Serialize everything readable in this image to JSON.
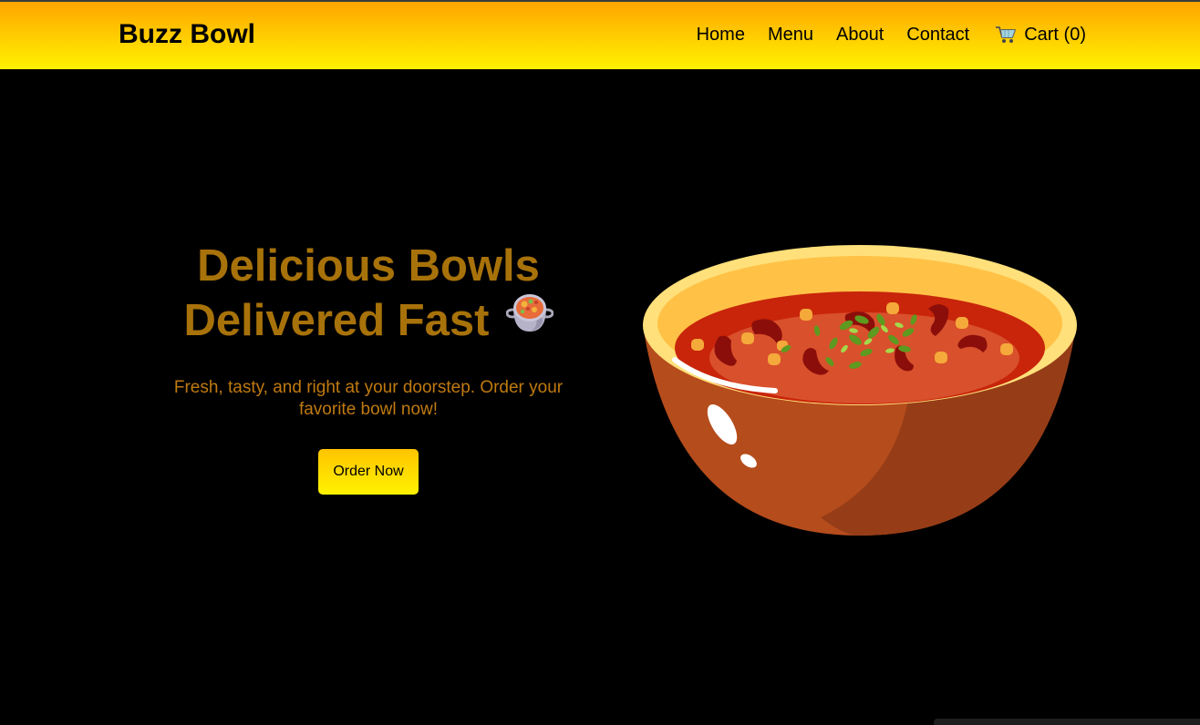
{
  "brand": {
    "name": "Buzz Bowl"
  },
  "nav": {
    "items": [
      {
        "label": "Home"
      },
      {
        "label": "Menu"
      },
      {
        "label": "About"
      },
      {
        "label": "Contact"
      }
    ],
    "cart": {
      "label": "Cart (0)",
      "icon": "shopping-cart-icon"
    }
  },
  "hero": {
    "title_line1": "Delicious Bowls",
    "title_line2": "Delivered Fast",
    "title_icon": "pot-of-food-icon",
    "subtitle": "Fresh, tasty, and right at your doorstep. Order your favorite bowl now!",
    "cta_label": "Order Now",
    "image": "soup-bowl-illustration"
  },
  "colors": {
    "nav_gradient_top": "#ffa500",
    "nav_gradient_bottom": "#fff200",
    "title": "#a8720a",
    "subtitle": "#c07a10",
    "background": "#000000"
  }
}
